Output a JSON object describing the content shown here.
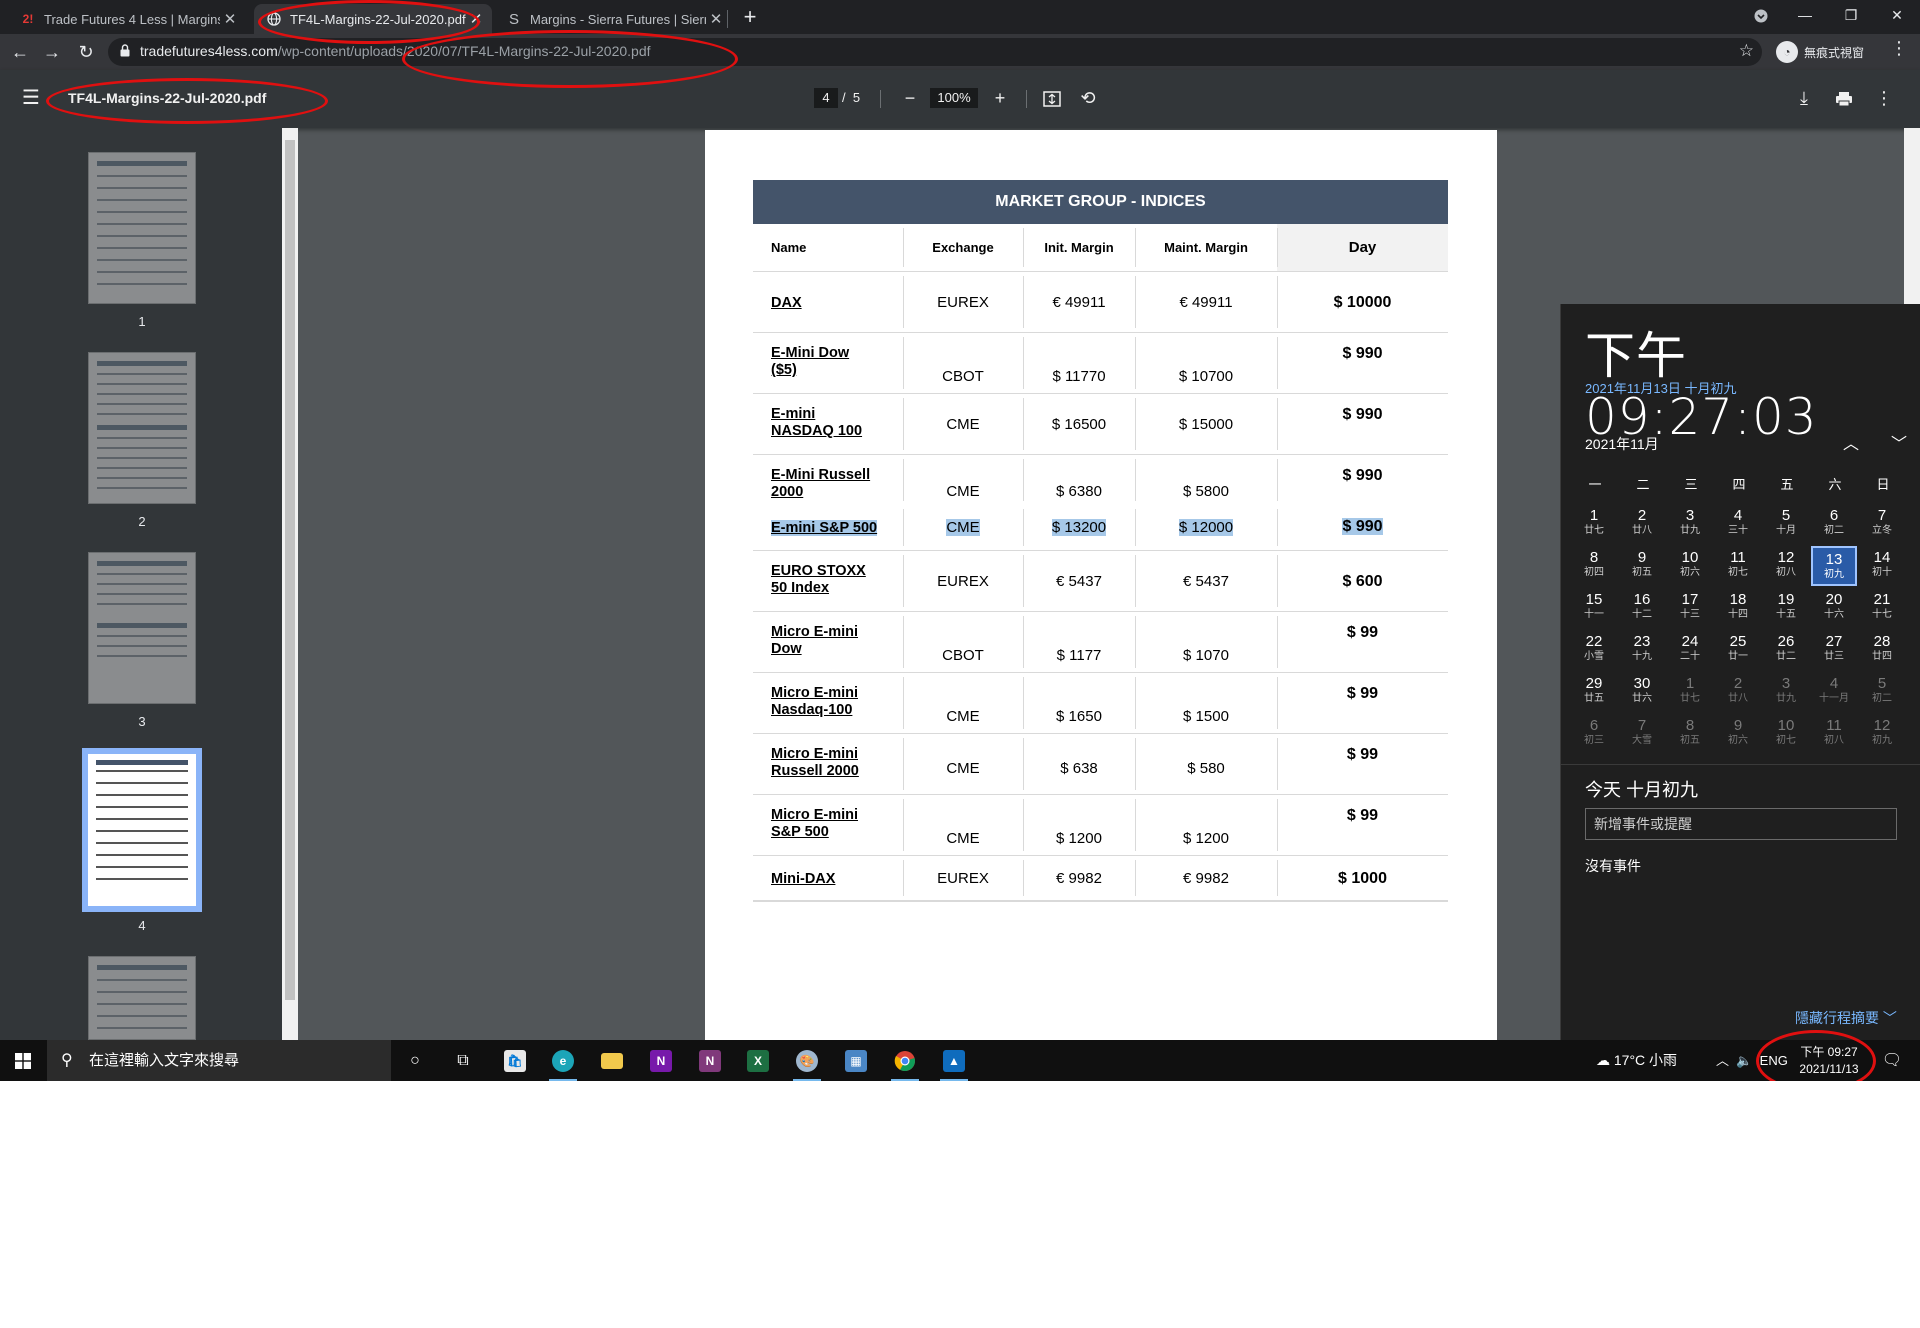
{
  "browser": {
    "tabs": [
      {
        "favicon": "tf4l-logo-icon",
        "favicon_text": "2!",
        "title": "Trade Futures 4 Less | Margins",
        "active": false
      },
      {
        "favicon": "globe-icon",
        "title": "TF4L-Margins-22-Jul-2020.pdf",
        "active": true
      },
      {
        "favicon": "sierra-s-icon",
        "favicon_text": "S",
        "title": "Margins - Sierra Futures | Sierra",
        "active": false
      }
    ],
    "url_host": "tradefutures4less.com",
    "url_path": "/wp-content/uploads/2020/07/TF4L-Margins-22-Jul-2020.pdf",
    "incognito_label": "無痕式視窗"
  },
  "pdf_viewer": {
    "file_name": "TF4L-Margins-22-Jul-2020.pdf",
    "current_page": "4",
    "page_separator": "/",
    "total_pages": "5",
    "zoom": "100%",
    "thumbnails": [
      "1",
      "2",
      "3",
      "4"
    ],
    "selected_thumbnail": 4
  },
  "margin_table": {
    "title": "MARKET GROUP - INDICES",
    "headers": {
      "name": "Name",
      "exchange": "Exchange",
      "init": "Init. Margin",
      "maint": "Maint. Margin",
      "day": "Day"
    },
    "rows": [
      {
        "name": "DAX",
        "exchange": "EUREX",
        "init": "€ 49911",
        "maint": "€ 49911",
        "day": "$ 10000"
      },
      {
        "name_line1": "E-Mini Dow",
        "name_line2": "($5)",
        "exchange": "CBOT",
        "init": "$ 11770",
        "maint": "$ 10700",
        "day": "$ 990"
      },
      {
        "name_line1": "E-mini",
        "name_line2": "NASDAQ 100",
        "exchange": "CME",
        "init": "$ 16500",
        "maint": "$ 15000",
        "day": "$ 990"
      },
      {
        "name_line1": "E-Mini Russell",
        "name_line2": "2000",
        "exchange": "CME",
        "init": "$ 6380",
        "maint": "$ 5800",
        "day": "$ 990"
      },
      {
        "name": "E-mini S&P 500",
        "exchange": "CME",
        "init": "$ 13200",
        "maint": "$ 12000",
        "day": "$ 990",
        "highlighted": true
      },
      {
        "name_line1": "EURO STOXX",
        "name_line2": "50 Index",
        "exchange": "EUREX",
        "init": "€ 5437",
        "maint": "€ 5437",
        "day": "$ 600"
      },
      {
        "name_line1": "Micro E-mini",
        "name_line2": "Dow",
        "exchange": "CBOT",
        "init": "$ 1177",
        "maint": "$ 1070",
        "day": "$ 99"
      },
      {
        "name_line1": "Micro E-mini",
        "name_line2": "Nasdaq-100",
        "exchange": "CME",
        "init": "$ 1650",
        "maint": "$ 1500",
        "day": "$ 99"
      },
      {
        "name_line1": "Micro E-mini",
        "name_line2": "Russell 2000",
        "exchange": "CME",
        "init": "$ 638",
        "maint": "$ 580",
        "day": "$ 99"
      },
      {
        "name_line1": "Micro E-mini",
        "name_line2": "S&P 500",
        "exchange": "CME",
        "init": "$ 1200",
        "maint": "$ 1200",
        "day": "$ 99"
      },
      {
        "name": "Mini-DAX",
        "exchange": "EUREX",
        "init": "€ 9982",
        "maint": "€ 9982",
        "day": "$ 1000"
      }
    ]
  },
  "clock_flyout": {
    "time": "下午 09:27:03",
    "date": "2021年11月13日 十月初九",
    "month_label": "2021年11月",
    "weekdays": [
      "一",
      "二",
      "三",
      "四",
      "五",
      "六",
      "日"
    ],
    "days": [
      {
        "n": "1",
        "l": "廿七"
      },
      {
        "n": "2",
        "l": "廿八"
      },
      {
        "n": "3",
        "l": "廿九"
      },
      {
        "n": "4",
        "l": "三十"
      },
      {
        "n": "5",
        "l": "十月"
      },
      {
        "n": "6",
        "l": "初二"
      },
      {
        "n": "7",
        "l": "立冬"
      },
      {
        "n": "8",
        "l": "初四"
      },
      {
        "n": "9",
        "l": "初五"
      },
      {
        "n": "10",
        "l": "初六"
      },
      {
        "n": "11",
        "l": "初七"
      },
      {
        "n": "12",
        "l": "初八"
      },
      {
        "n": "13",
        "l": "初九",
        "today": true
      },
      {
        "n": "14",
        "l": "初十"
      },
      {
        "n": "15",
        "l": "十一"
      },
      {
        "n": "16",
        "l": "十二"
      },
      {
        "n": "17",
        "l": "十三"
      },
      {
        "n": "18",
        "l": "十四"
      },
      {
        "n": "19",
        "l": "十五"
      },
      {
        "n": "20",
        "l": "十六"
      },
      {
        "n": "21",
        "l": "十七"
      },
      {
        "n": "22",
        "l": "小雪"
      },
      {
        "n": "23",
        "l": "十九"
      },
      {
        "n": "24",
        "l": "二十"
      },
      {
        "n": "25",
        "l": "廿一"
      },
      {
        "n": "26",
        "l": "廿二"
      },
      {
        "n": "27",
        "l": "廿三"
      },
      {
        "n": "28",
        "l": "廿四"
      },
      {
        "n": "29",
        "l": "廿五"
      },
      {
        "n": "30",
        "l": "廿六"
      },
      {
        "n": "1",
        "l": "廿七",
        "dim": true
      },
      {
        "n": "2",
        "l": "廿八",
        "dim": true
      },
      {
        "n": "3",
        "l": "廿九",
        "dim": true
      },
      {
        "n": "4",
        "l": "十一月",
        "dim": true
      },
      {
        "n": "5",
        "l": "初二",
        "dim": true
      },
      {
        "n": "6",
        "l": "初三",
        "dim": true
      },
      {
        "n": "7",
        "l": "大雪",
        "dim": true
      },
      {
        "n": "8",
        "l": "初五",
        "dim": true
      },
      {
        "n": "9",
        "l": "初六",
        "dim": true
      },
      {
        "n": "10",
        "l": "初七",
        "dim": true
      },
      {
        "n": "11",
        "l": "初八",
        "dim": true
      },
      {
        "n": "12",
        "l": "初九",
        "dim": true
      }
    ],
    "today_label": "今天 十月初九",
    "event_placeholder": "新增事件或提醒",
    "no_events": "沒有事件",
    "hide_agenda": "隱藏行程摘要"
  },
  "taskbar": {
    "search_placeholder": "在這裡輸入文字來搜尋",
    "weather": "17°C 小雨",
    "language": "ENG",
    "time": "下午 09:27",
    "date": "2021/11/13",
    "apps": [
      "cortana-icon",
      "task-view-icon",
      "store-icon",
      "edge-icon",
      "file-explorer-icon",
      "onenote-icon",
      "onenote-2016-icon",
      "excel-icon",
      "paint-icon",
      "calculator-icon",
      "chrome-icon",
      "photos-icon"
    ]
  },
  "annotation_color": "#e01010"
}
